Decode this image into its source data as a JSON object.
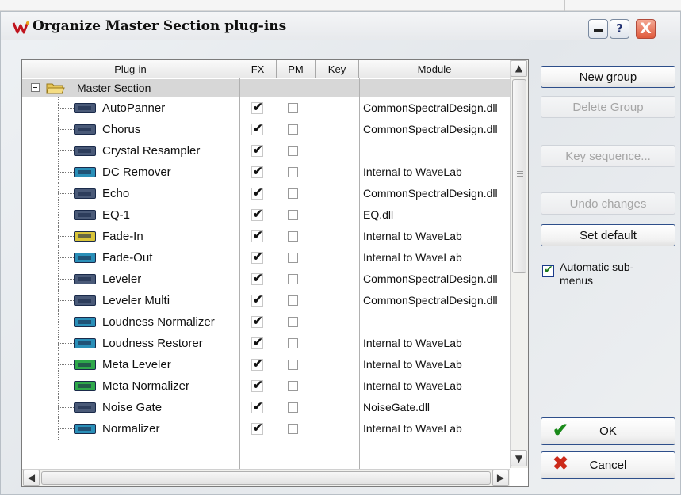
{
  "window": {
    "title": "Organize Master Section plug-ins"
  },
  "titlebar": {
    "help_label": "?",
    "close_label": "X"
  },
  "table": {
    "columns": [
      "Plug-in",
      "FX",
      "PM",
      "Key",
      "Module"
    ],
    "group": {
      "label": "Master Section"
    },
    "rows": [
      {
        "name": "AutoPanner",
        "fx": true,
        "pm": false,
        "key": "",
        "module": "CommonSpectralDesign.dll",
        "icon_color": "#4a5a78"
      },
      {
        "name": "Chorus",
        "fx": true,
        "pm": false,
        "key": "",
        "module": "CommonSpectralDesign.dll",
        "icon_color": "#4a5a78"
      },
      {
        "name": "Crystal Resampler",
        "fx": true,
        "pm": false,
        "key": "",
        "module": "",
        "icon_color": "#4a5a78"
      },
      {
        "name": "DC Remover",
        "fx": true,
        "pm": false,
        "key": "",
        "module": "Internal to WaveLab",
        "icon_color": "#2a8fb8"
      },
      {
        "name": "Echo",
        "fx": true,
        "pm": false,
        "key": "",
        "module": "CommonSpectralDesign.dll",
        "icon_color": "#4a5a78"
      },
      {
        "name": "EQ-1",
        "fx": true,
        "pm": false,
        "key": "",
        "module": "EQ.dll",
        "icon_color": "#4a5a78"
      },
      {
        "name": "Fade-In",
        "fx": true,
        "pm": false,
        "key": "",
        "module": "Internal to WaveLab",
        "icon_color": "#d8c43a"
      },
      {
        "name": "Fade-Out",
        "fx": true,
        "pm": false,
        "key": "",
        "module": "Internal to WaveLab",
        "icon_color": "#2a8fb8"
      },
      {
        "name": "Leveler",
        "fx": true,
        "pm": false,
        "key": "",
        "module": "CommonSpectralDesign.dll",
        "icon_color": "#4a5a78"
      },
      {
        "name": "Leveler Multi",
        "fx": true,
        "pm": false,
        "key": "",
        "module": "CommonSpectralDesign.dll",
        "icon_color": "#4a5a78"
      },
      {
        "name": "Loudness Normalizer",
        "fx": true,
        "pm": false,
        "key": "",
        "module": "",
        "icon_color": "#2a8fb8"
      },
      {
        "name": "Loudness Restorer",
        "fx": true,
        "pm": false,
        "key": "",
        "module": "Internal to WaveLab",
        "icon_color": "#2a8fb8"
      },
      {
        "name": "Meta Leveler",
        "fx": true,
        "pm": false,
        "key": "",
        "module": "Internal to WaveLab",
        "icon_color": "#2ea84a"
      },
      {
        "name": "Meta Normalizer",
        "fx": true,
        "pm": false,
        "key": "",
        "module": "Internal to WaveLab",
        "icon_color": "#2ea84a"
      },
      {
        "name": "Noise Gate",
        "fx": true,
        "pm": false,
        "key": "",
        "module": "NoiseGate.dll",
        "icon_color": "#4a5a78"
      },
      {
        "name": "Normalizer",
        "fx": true,
        "pm": false,
        "key": "",
        "module": "Internal to WaveLab",
        "icon_color": "#2a8fb8"
      }
    ]
  },
  "buttons": {
    "new_group": "New group",
    "delete_group": "Delete Group",
    "key_sequence": "Key sequence...",
    "undo_changes": "Undo changes",
    "set_default": "Set default",
    "ok": "OK",
    "cancel": "Cancel"
  },
  "options": {
    "automatic_submenus_label": "Automatic sub-menus",
    "automatic_submenus_checked": true
  },
  "colors": {
    "accent": "#2d4e8a",
    "ok_icon": "#1a8a1a",
    "cancel_icon": "#cc2a1a",
    "close_button": "#e05a3c"
  }
}
